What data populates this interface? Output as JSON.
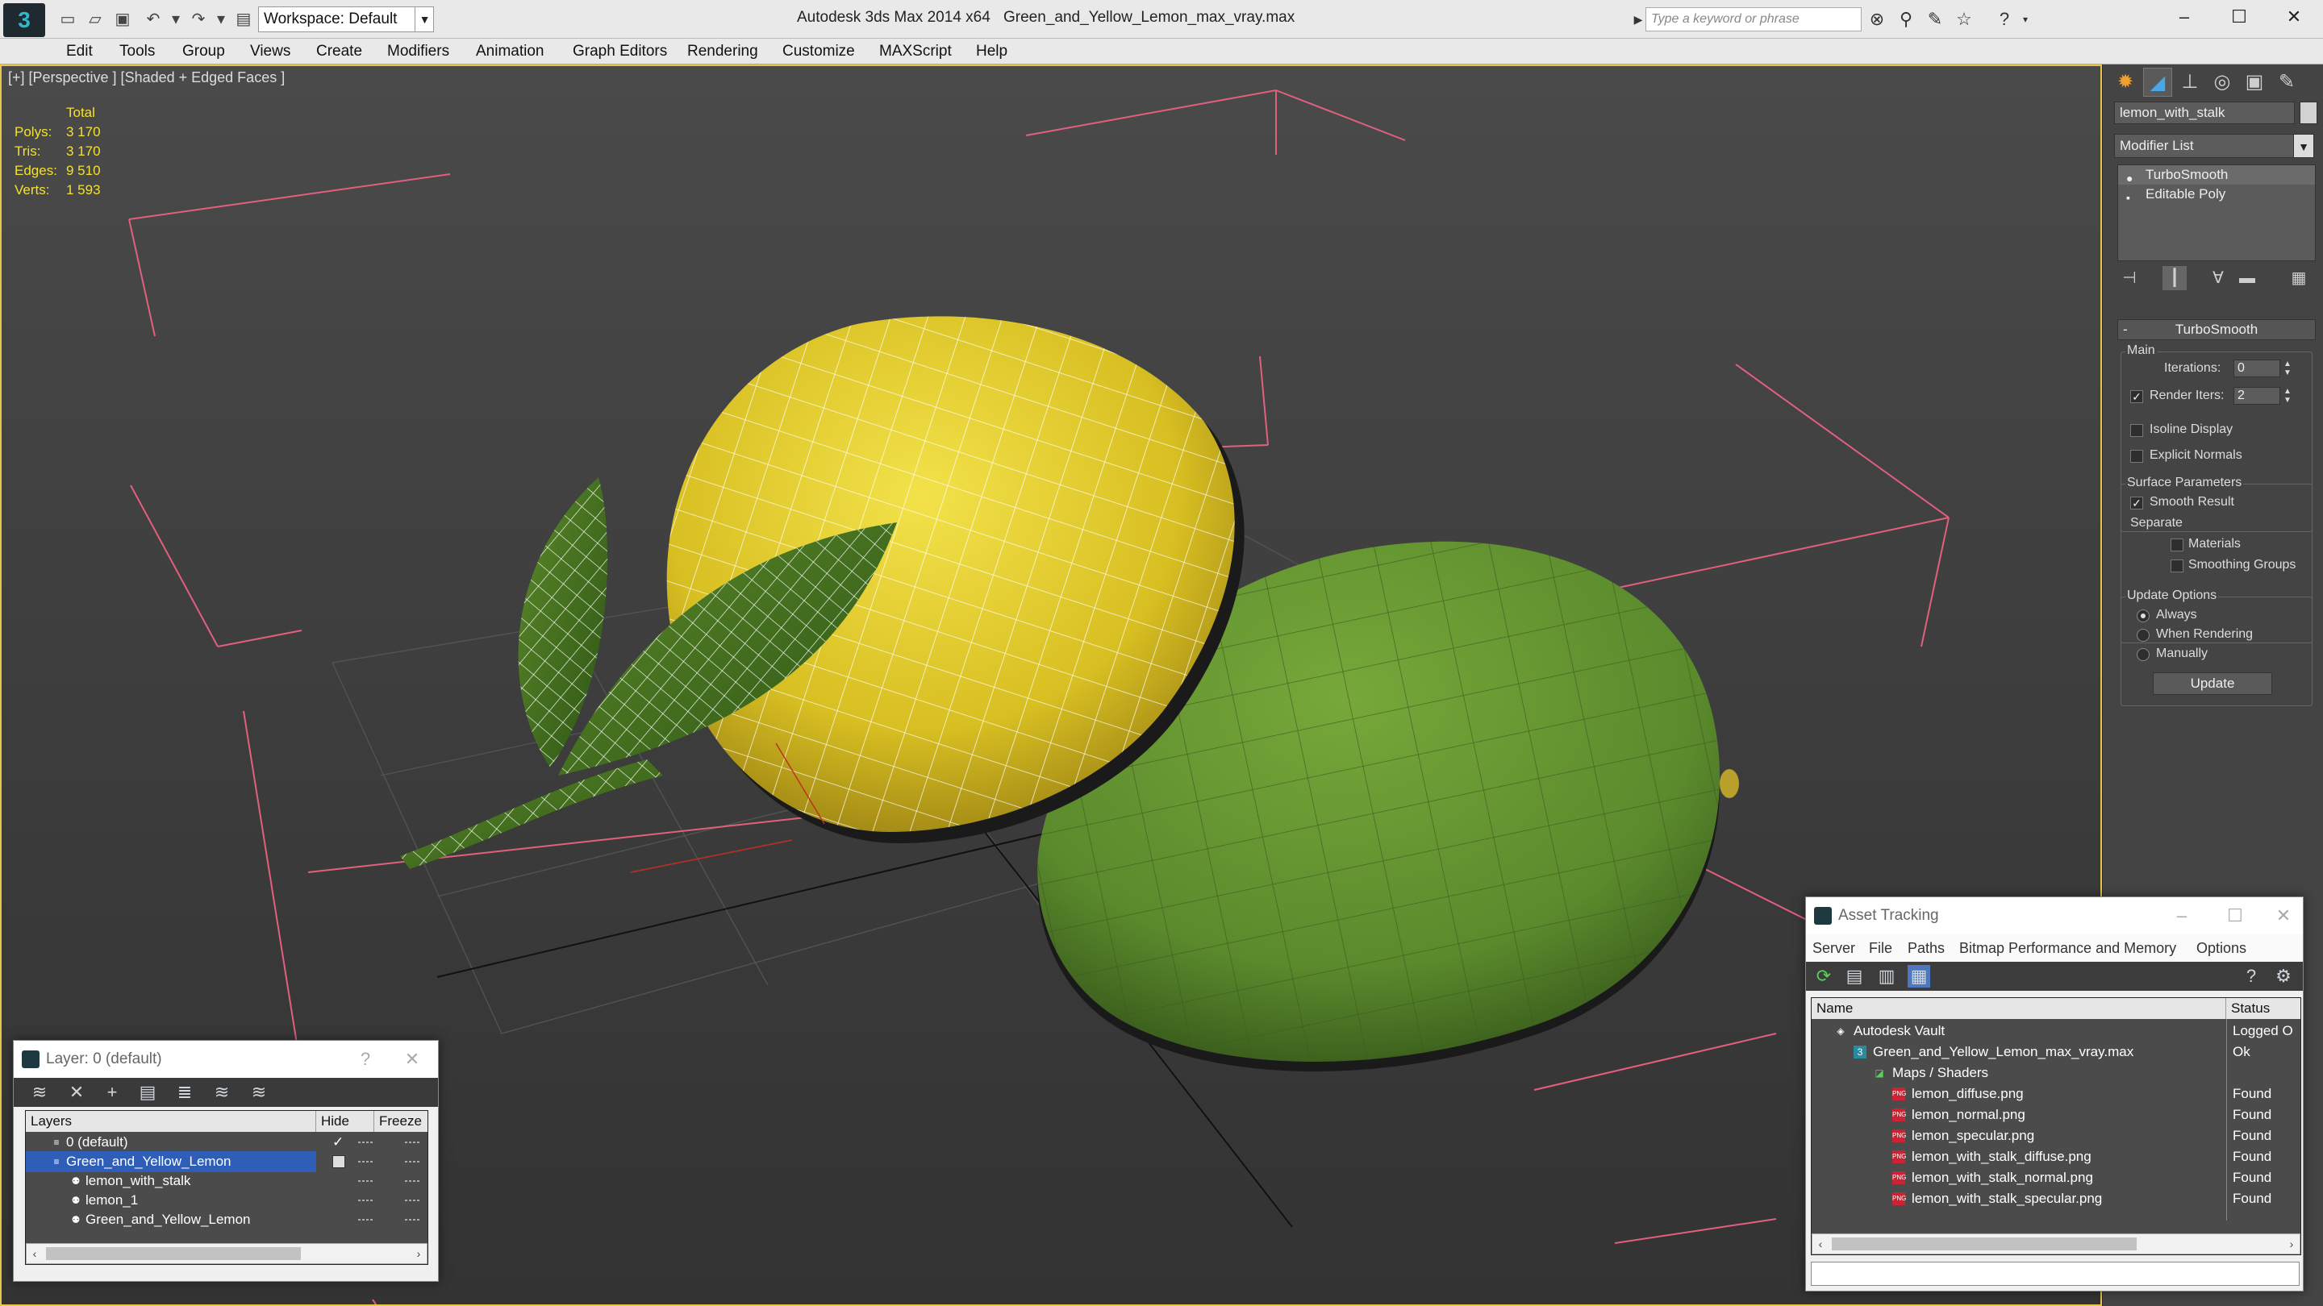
{
  "titlebar": {
    "workspace": "Workspace: Default",
    "app_title": "Autodesk 3ds Max  2014 x64",
    "file_title": "Green_and_Yellow_Lemon_max_vray.max",
    "search_placeholder": "Type a keyword or phrase",
    "window_min": "–",
    "window_max": "☐",
    "window_close": "✕"
  },
  "menubar": {
    "items": [
      "Edit",
      "Tools",
      "Group",
      "Views",
      "Create",
      "Modifiers",
      "Animation",
      "Graph Editors",
      "Rendering",
      "Customize",
      "MAXScript",
      "Help"
    ]
  },
  "viewport": {
    "label": "[+] [Perspective ] [Shaded + Edged Faces ]",
    "stats": {
      "header": "Total",
      "rows": [
        {
          "k": "Polys:",
          "v": "3 170"
        },
        {
          "k": "Tris:",
          "v": "3 170"
        },
        {
          "k": "Edges:",
          "v": "9 510"
        },
        {
          "k": "Verts:",
          "v": "1 593"
        }
      ]
    }
  },
  "command_panel": {
    "object_name": "lemon_with_stalk",
    "modifier_list": "Modifier List",
    "stack": [
      "TurboSmooth",
      "Editable Poly"
    ],
    "rollout_title": "TurboSmooth",
    "main_group": "Main",
    "iterations_label": "Iterations:",
    "iterations_value": "0",
    "render_iters_label": "Render Iters:",
    "render_iters_value": "2",
    "isoline_display": "Isoline Display",
    "explicit_normals": "Explicit Normals",
    "surface_params": "Surface Parameters",
    "smooth_result": "Smooth Result",
    "separate": "Separate",
    "materials": "Materials",
    "smoothing_groups": "Smoothing Groups",
    "update_options": "Update Options",
    "always": "Always",
    "when_rendering": "When Rendering",
    "manually": "Manually",
    "update_button": "Update"
  },
  "layer_dialog": {
    "title": "Layer: 0 (default)",
    "help": "?",
    "close": "✕",
    "col_layers": "Layers",
    "col_hide": "Hide",
    "col_freeze": "Freeze",
    "rows": [
      "0 (default)",
      "Green_and_Yellow_Lemon",
      "lemon_with_stalk",
      "lemon_1",
      "Green_and_Yellow_Lemon"
    ]
  },
  "asset_dialog": {
    "title": "Asset Tracking",
    "menu": [
      "Server",
      "File",
      "Paths",
      "Bitmap Performance and Memory",
      "Options"
    ],
    "col_name": "Name",
    "col_status": "Status",
    "rows": [
      {
        "name": "Autodesk Vault",
        "status": "Logged O"
      },
      {
        "name": "Green_and_Yellow_Lemon_max_vray.max",
        "status": "Ok"
      },
      {
        "name": "Maps / Shaders",
        "status": ""
      },
      {
        "name": "lemon_diffuse.png",
        "status": "Found"
      },
      {
        "name": "lemon_normal.png",
        "status": "Found"
      },
      {
        "name": "lemon_specular.png",
        "status": "Found"
      },
      {
        "name": "lemon_with_stalk_diffuse.png",
        "status": "Found"
      },
      {
        "name": "lemon_with_stalk_normal.png",
        "status": "Found"
      },
      {
        "name": "lemon_with_stalk_specular.png",
        "status": "Found"
      }
    ]
  },
  "colors": {
    "viewport_border": "#e8c44a",
    "stats_text": "#f4e030",
    "lemon_yellow": "#e0c82a",
    "lime_green": "#5f8f2e",
    "selection_blue": "#2e5eb8"
  }
}
